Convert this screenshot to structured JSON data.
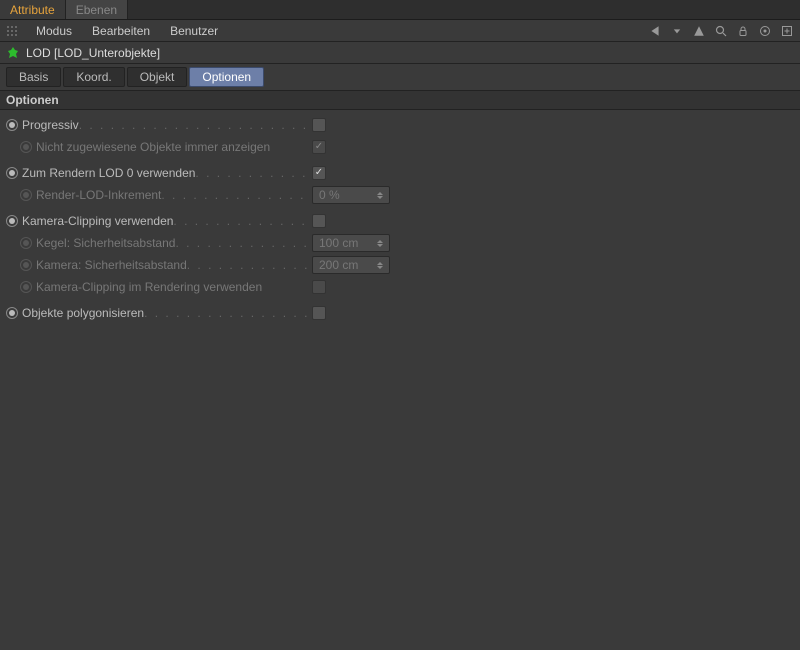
{
  "tabs": {
    "attribute": "Attribute",
    "ebenen": "Ebenen"
  },
  "menu": {
    "modus": "Modus",
    "bearbeiten": "Bearbeiten",
    "benutzer": "Benutzer"
  },
  "object": {
    "title": "LOD [LOD_Unterobjekte]"
  },
  "subtabs": {
    "basis": "Basis",
    "koord": "Koord.",
    "objekt": "Objekt",
    "optionen": "Optionen"
  },
  "section": {
    "title": "Optionen"
  },
  "opts": {
    "progressive": "Progressiv",
    "show_unassigned": "Nicht zugewiesene Objekte immer anzeigen",
    "render_lod0": "Zum Rendern LOD 0 verwenden",
    "render_lod_inc": "Render-LOD-Inkrement",
    "render_lod_inc_val": "0 %",
    "cam_clipping": "Kamera-Clipping verwenden",
    "cone_safety": "Kegel: Sicherheitsabstand",
    "cone_safety_val": "100 cm",
    "cam_safety": "Kamera: Sicherheitsabstand",
    "cam_safety_val": "200 cm",
    "cam_clip_render": "Kamera-Clipping im Rendering verwenden",
    "polygonize": "Objekte polygonisieren"
  }
}
